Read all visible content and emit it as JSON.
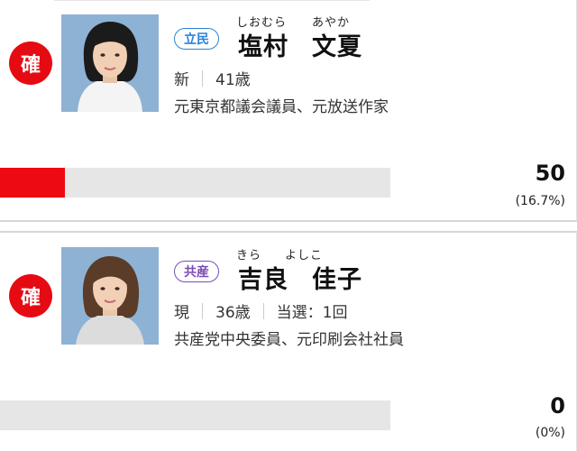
{
  "candidates": [
    {
      "badge": "確",
      "party": "立民",
      "party_color": "#2a84d6",
      "kana_family": "しおむら",
      "kana_given": "あやか",
      "name_family": "塩村",
      "name_given": "文夏",
      "status": "新",
      "age": "41歳",
      "career": "元東京都議会議員、元放送作家",
      "votes": "50",
      "percent_label": "(16.7%)",
      "share": 16.7
    },
    {
      "badge": "確",
      "party": "共産",
      "party_color": "#7d4bb8",
      "kana_family": "きら",
      "kana_given": "よしこ",
      "name_family": "吉良",
      "name_given": "佳子",
      "status": "現",
      "age": "36歳",
      "elected": "当選：1回",
      "career": "共産党中央委員、元印刷会社社員",
      "votes": "0",
      "percent_label": "(0%)",
      "share": 0
    }
  ],
  "colors": {
    "badge": "#e60b13",
    "bar_fill": "#ee0a12",
    "bar_track": "#e6e6e6"
  }
}
